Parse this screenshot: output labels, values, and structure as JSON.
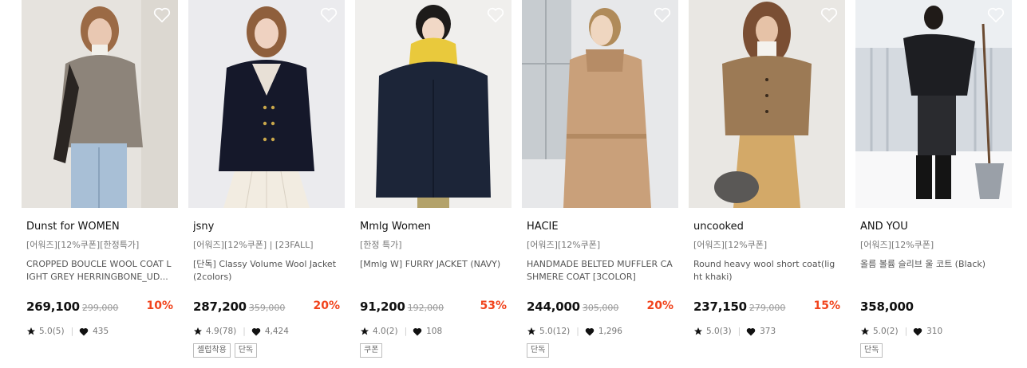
{
  "icons": {
    "wishlist": "heart-outline-icon",
    "rating": "star-icon",
    "likes": "heart-filled-icon"
  },
  "colors": {
    "discount": "#f1441d",
    "text": "#111111",
    "muted": "#777777"
  },
  "products": [
    {
      "brand": "Dunst for WOMEN",
      "tag": "[어워즈][12%쿠폰][한정특가]",
      "name": "CROPPED BOUCLE WOOL COAT LIGHT GREY HERRINGBONE_UD...",
      "price": "269,100",
      "original": "299,000",
      "discount": "10%",
      "rating": "5.0(5)",
      "likes": "435",
      "badges": []
    },
    {
      "brand": "jsny",
      "tag": "[어워즈][12%쿠폰] | [23FALL]",
      "name": "[단독] Classy Volume Wool Jacket (2colors)",
      "price": "287,200",
      "original": "359,000",
      "discount": "20%",
      "rating": "4.9(78)",
      "likes": "4,424",
      "badges": [
        "셀럽착용",
        "단독"
      ]
    },
    {
      "brand": "Mmlg Women",
      "tag": "[한정 특가]",
      "name": "[Mmlg W] FURRY JACKET (NAVY)",
      "price": "91,200",
      "original": "192,000",
      "discount": "53%",
      "rating": "4.0(2)",
      "likes": "108",
      "badges": [
        "쿠폰"
      ]
    },
    {
      "brand": "HACIE",
      "tag": "[어워즈][12%쿠폰]",
      "name": "HANDMADE BELTED MUFFLER CASHMERE COAT [3COLOR]",
      "price": "244,000",
      "original": "305,000",
      "discount": "20%",
      "rating": "5.0(12)",
      "likes": "1,296",
      "badges": [
        "단독"
      ]
    },
    {
      "brand": "uncooked",
      "tag": "[어워즈][12%쿠폰]",
      "name": "Round heavy wool short coat(light khaki)",
      "price": "237,150",
      "original": "279,000",
      "discount": "15%",
      "rating": "5.0(3)",
      "likes": "373",
      "badges": []
    },
    {
      "brand": "AND YOU",
      "tag": "[어워즈][12%쿠폰]",
      "name": "올름 볼륨 슬리브 울 코트 (Black)",
      "price": "358,000",
      "original": "",
      "discount": "",
      "rating": "5.0(2)",
      "likes": "310",
      "badges": [
        "단독"
      ]
    }
  ]
}
